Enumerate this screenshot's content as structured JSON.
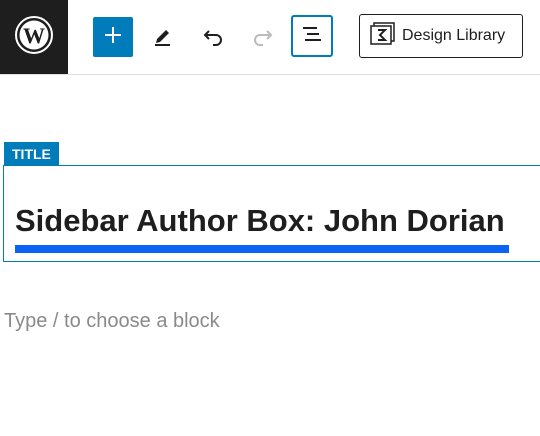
{
  "toolbar": {
    "logo_icon": "wordpress-logo-icon",
    "add_block_icon": "plus-icon",
    "tools_icon": "pencil-icon",
    "undo_icon": "undo-icon",
    "redo_icon": "redo-icon",
    "list_view_icon": "list-view-icon",
    "design_library": {
      "icon": "design-library-icon",
      "label": "Design Library"
    },
    "colors": {
      "accent": "#007cba",
      "logo_bg": "#1e1e1e"
    }
  },
  "editor": {
    "block_badge": "TITLE",
    "post_title": "Sidebar Author Box: John Dorian",
    "underline_color": "#0b63f6",
    "appender_placeholder": "Type / to choose a block"
  }
}
